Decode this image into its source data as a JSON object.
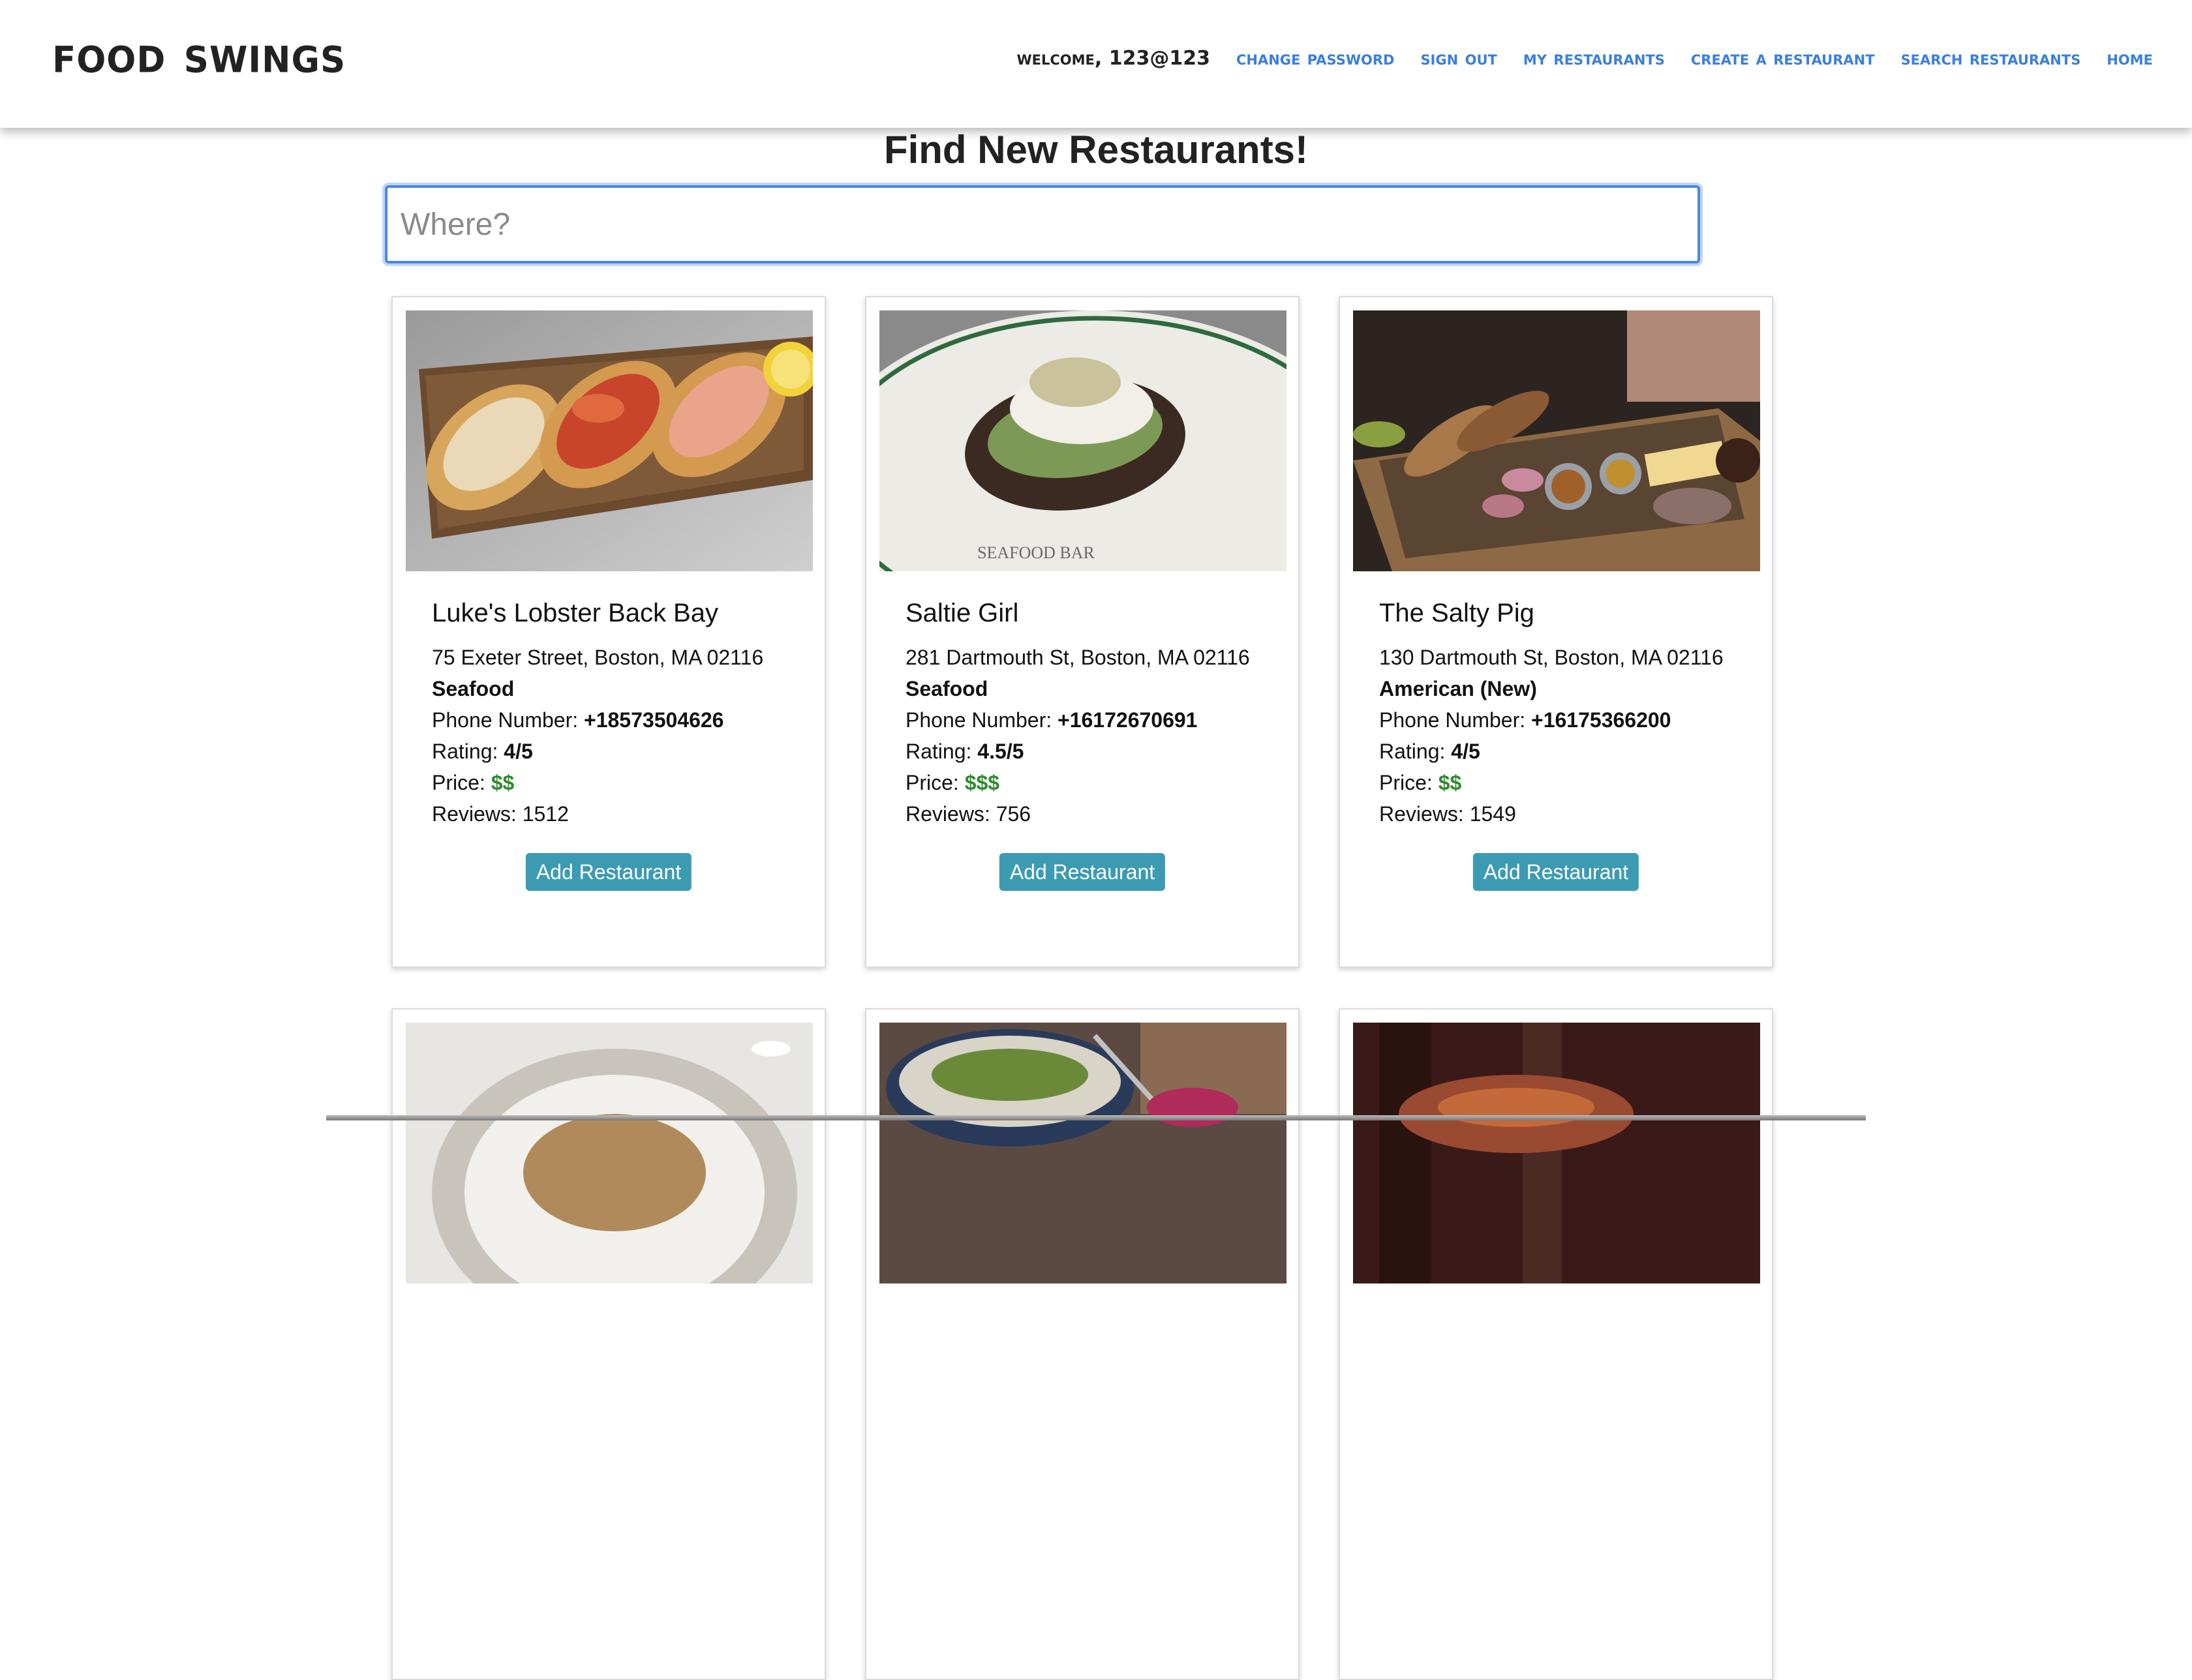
{
  "brand": "Food Swings",
  "nav": {
    "welcome": "Welcome, 123@123",
    "links": [
      "Change Password",
      "Sign Out",
      "My Restaurants",
      "Create a Restaurant",
      "Search Restaurants",
      "Home"
    ]
  },
  "search": {
    "title": "Find New Restaurants!",
    "placeholder": "Where?",
    "value": ""
  },
  "labels": {
    "phone": "Phone Number: ",
    "rating": "Rating: ",
    "price": "Price: ",
    "reviews": "Reviews: ",
    "add_button": "Add Restaurant"
  },
  "restaurants": [
    {
      "name": "Luke's Lobster Back Bay",
      "address": "75 Exeter Street, Boston, MA 02116",
      "category": "Seafood",
      "phone": "+18573504626",
      "rating": "4/5",
      "price": "$$",
      "reviews": "1512",
      "image": "lobster-rolls-photo"
    },
    {
      "name": "Saltie Girl",
      "address": "281 Dartmouth St, Boston, MA 02116",
      "category": "Seafood",
      "phone": "+16172670691",
      "rating": "4.5/5",
      "price": "$$$",
      "reviews": "756",
      "image": "seafood-toast-photo"
    },
    {
      "name": "The Salty Pig",
      "address": "130 Dartmouth St, Boston, MA 02116",
      "category": "American (New)",
      "phone": "+16175366200",
      "rating": "4/5",
      "price": "$$",
      "reviews": "1549",
      "image": "charcuterie-board-photo"
    }
  ],
  "colors": {
    "nav_link": "#3a7fe0",
    "button": "#3c9bb3",
    "price": "#2e8b2e",
    "focus": "#4a86e8"
  }
}
